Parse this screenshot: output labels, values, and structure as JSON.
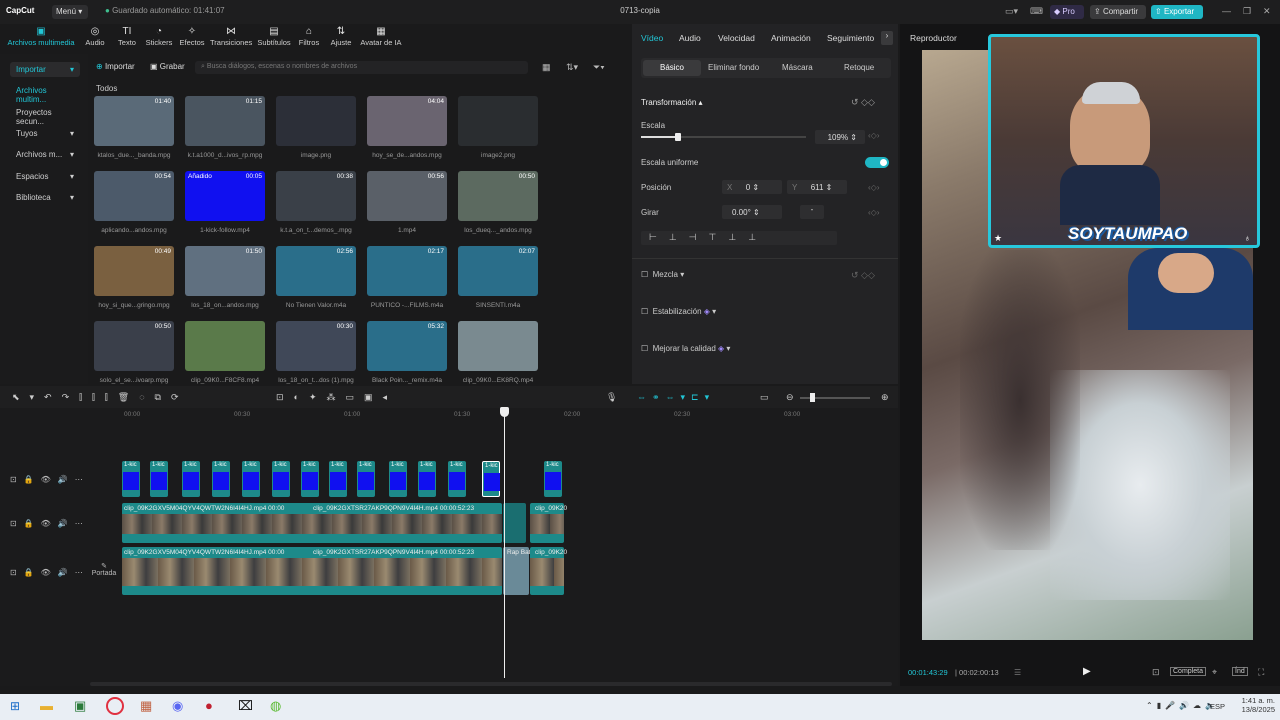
{
  "app": {
    "logo": "CapCut",
    "menu": "Menú",
    "autosave": "Guardado automático: 01:41:07",
    "title": "0713-copia",
    "pro": "Pro",
    "share": "Compartir",
    "export": "Exportar"
  },
  "toolbar": [
    {
      "label": "Archivos multimedia",
      "icon": "media-icon"
    },
    {
      "label": "Audio",
      "icon": "audio-icon"
    },
    {
      "label": "Texto",
      "icon": "text-icon"
    },
    {
      "label": "Stickers",
      "icon": "sticker-icon"
    },
    {
      "label": "Efectos",
      "icon": "effects-icon"
    },
    {
      "label": "Transiciones",
      "icon": "transition-icon"
    },
    {
      "label": "Subtítulos",
      "icon": "subtitle-icon"
    },
    {
      "label": "Filtros",
      "icon": "filter-icon"
    },
    {
      "label": "Ajuste",
      "icon": "adjust-icon"
    },
    {
      "label": "Avatar de IA",
      "icon": "avatar-icon"
    }
  ],
  "sidebar": [
    {
      "label": "Importar"
    },
    {
      "label": "Archivos multim..."
    },
    {
      "label": "Proyectos secun..."
    },
    {
      "label": "Tuyos"
    },
    {
      "label": "Archivos m..."
    },
    {
      "label": "Espacios"
    },
    {
      "label": "Biblioteca"
    }
  ],
  "media": {
    "import": "Importar",
    "record": "Grabar",
    "search_placeholder": "Busca diálogos, escenas o nombres de archivos",
    "section": "Todos",
    "items": [
      {
        "label": "ktalos_due..._banda.mpg",
        "dur": "01:40",
        "color": "#5a6a78"
      },
      {
        "label": "k.t.a1000_d...ivos_rp.mpg",
        "dur": "01:15",
        "color": "#4a5560"
      },
      {
        "label": "image.png",
        "dur": "",
        "color": "#2c2f38"
      },
      {
        "label": "hoy_se_de...andos.mpg",
        "dur": "04:04",
        "color": "#6a6470"
      },
      {
        "label": "image2.png",
        "dur": "",
        "color": "#2a2d30"
      },
      {
        "label": "aplicando...andos.mpg",
        "dur": "00:54",
        "color": "#4c5a6a"
      },
      {
        "label": "1-kick-follow.mp4",
        "dur": "00:05",
        "color": "#1010f0",
        "badge": "Añadido"
      },
      {
        "label": "k.t.a_on_t...demos_.mpg",
        "dur": "00:38",
        "color": "#3a4048"
      },
      {
        "label": "1.mp4",
        "dur": "00:56",
        "color": "#5a6068"
      },
      {
        "label": "los_dueq..._andos.mpg",
        "dur": "00:50",
        "color": "#5c6a60"
      },
      {
        "label": "hoy_si_que...gringo.mpg",
        "dur": "00:49",
        "color": "#7a6040"
      },
      {
        "label": "los_18_on...andos.mpg",
        "dur": "01:50",
        "color": "#607080"
      },
      {
        "label": "No Tienen Valor.m4a",
        "dur": "02:56",
        "color": "#2a6e8a"
      },
      {
        "label": "PUNTICO -...FILMS.m4a",
        "dur": "02:17",
        "color": "#2a6e8a"
      },
      {
        "label": "SINSENTI.m4a",
        "dur": "02:07",
        "color": "#2a6e8a"
      },
      {
        "label": "solo_el_se...ivoarp.mpg",
        "dur": "00:50",
        "color": "#3a3f4a"
      },
      {
        "label": "clip_09K0...F8CF8.mp4",
        "dur": "",
        "color": "#5a7a4a"
      },
      {
        "label": "los_18_on_t...dos (1).mpg",
        "dur": "00:30",
        "color": "#404858"
      },
      {
        "label": "Black Poin..._remix.m4a",
        "dur": "05:32",
        "color": "#2a6e8a"
      },
      {
        "label": "clip_09K0...EK8RQ.mp4",
        "dur": "",
        "color": "#7a8a90"
      }
    ]
  },
  "props": {
    "tabs": [
      "Vídeo",
      "Audio",
      "Velocidad",
      "Animación",
      "Seguimiento"
    ],
    "subtabs": [
      "Básico",
      "Eliminar fondo",
      "Máscara",
      "Retoque"
    ],
    "transform": "Transformación",
    "scale_label": "Escala",
    "scale_value": "109%",
    "scale_fraction": 0.109,
    "uniform": "Escala uniforme",
    "position": "Posición",
    "pos_x_label": "X",
    "pos_x": "0",
    "pos_y_label": "Y",
    "pos_y": "611",
    "rotate": "Girar",
    "rotate_value": "0.00°",
    "rotate_extra": "-",
    "blend": "Mezcla",
    "stabilize": "Estabilización",
    "enhance": "Mejorar la calidad"
  },
  "player": {
    "title": "Reproductor",
    "current": "00:01:43:29",
    "total": "00:02:00:13",
    "full": "Completa",
    "ratio": "Índ",
    "streamer": "SOYTAUMPAO"
  },
  "timeline": {
    "ruler": [
      "00:00",
      "00:30",
      "01:00",
      "01:30",
      "02:00",
      "02:30",
      "03:00"
    ],
    "clip_label": "1-kic",
    "video_clip_1": "clip_09K2GXV5M04QYV4QWTW2N6I4I4HJ.mp4",
    "video_time_1": "00:00",
    "video_clip_2": "clip_09K2GXTSR27AKP9QPN9V4I4H.mp4",
    "video_time_2": "00:00:52:23",
    "video_clip_tail": "clip_09K20",
    "video_clip_3": "clip_09K2GXV5M04QYV4QWTW2N6I4I4HJ.mp4",
    "video_time_3": "00:00",
    "video_clip_4": "clip_09K2GXTSR27AKP9QPN9V4I4H.mp4",
    "video_time_4": "00:00:52:23",
    "rap_label": "Rap Bat",
    "video_clip_tail2": "clip_09K20",
    "cover": "Portada"
  },
  "taskbar": {
    "lang": "ESP",
    "time": "1:41 a. m.",
    "date": "13/8/2025"
  }
}
